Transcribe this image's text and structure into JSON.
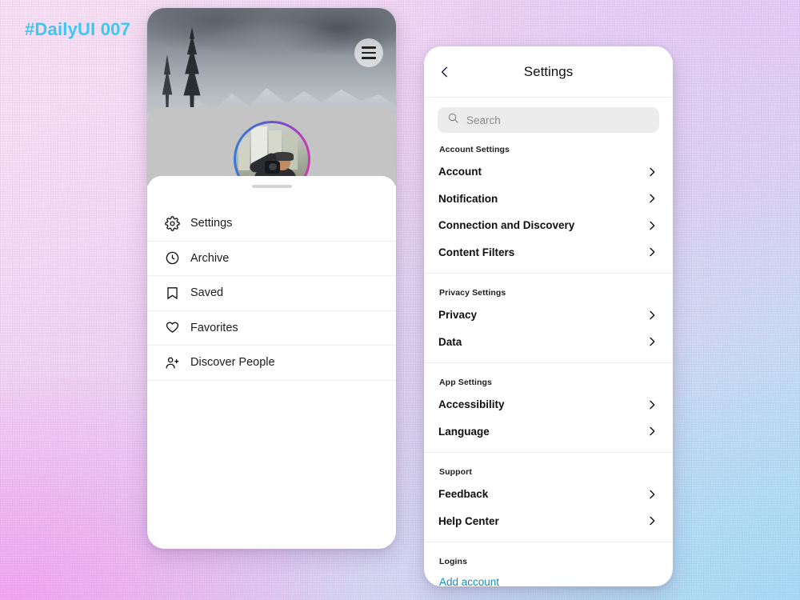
{
  "headline": "#DailyUI 007",
  "colors": {
    "accent_cyan": "#3ec8f0",
    "link_blue": "#1a8cba",
    "back_chevron": "#1a1a5c",
    "search_bg": "#ececec",
    "profile_band": "#c4c4c4"
  },
  "left_phone": {
    "cover_photo_alt": "snowy mountain range with pine tree",
    "menu_button": "hamburger-menu",
    "avatar_alt": "person holding camera",
    "drag_handle": true,
    "menu_items": [
      {
        "label": "Settings",
        "icon": "gear-icon"
      },
      {
        "label": "Archive",
        "icon": "clock-icon"
      },
      {
        "label": "Saved",
        "icon": "bookmark-icon"
      },
      {
        "label": "Favorites",
        "icon": "heart-icon"
      },
      {
        "label": "Discover People",
        "icon": "person-add-icon"
      }
    ]
  },
  "right_phone": {
    "header": {
      "title": "Settings",
      "back_icon": "chevron-left-icon"
    },
    "search": {
      "placeholder": "Search",
      "value": "",
      "icon": "search-icon"
    },
    "sections": [
      {
        "title": "Account Settings",
        "items": [
          {
            "label": "Account"
          },
          {
            "label": "Notification"
          },
          {
            "label": "Connection and Discovery"
          },
          {
            "label": "Content Filters"
          }
        ]
      },
      {
        "title": "Privacy Settings",
        "items": [
          {
            "label": "Privacy"
          },
          {
            "label": "Data"
          }
        ]
      },
      {
        "title": "App Settings",
        "items": [
          {
            "label": "Accessibility"
          },
          {
            "label": "Language"
          }
        ]
      },
      {
        "title": "Support",
        "items": [
          {
            "label": "Feedback"
          },
          {
            "label": "Help Center"
          }
        ]
      }
    ],
    "logins": {
      "title": "Logins",
      "add_account_label": "Add account"
    }
  }
}
